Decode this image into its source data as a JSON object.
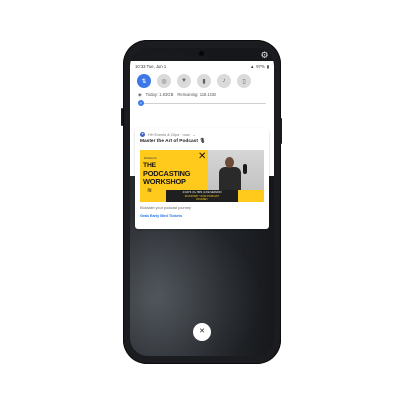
{
  "status_bar": {
    "time_date": "10:33 Tue, Jun 1",
    "battery": "97%"
  },
  "quick_settings": {
    "tiles": [
      {
        "name": "mobile-data",
        "glyph": "⇅",
        "active": true
      },
      {
        "name": "hotspot",
        "glyph": "◎",
        "active": false
      },
      {
        "name": "wifi",
        "glyph": "▼",
        "active": false
      },
      {
        "name": "flashlight",
        "glyph": "▮",
        "active": false
      },
      {
        "name": "notifications",
        "glyph": "♪",
        "active": false
      },
      {
        "name": "rotate",
        "glyph": "▯",
        "active": false
      }
    ],
    "data_usage": {
      "today": "Today: 1.93GB",
      "remaining": "Remaining: 118.1GB"
    },
    "accent": "#3c79e6"
  },
  "notification": {
    "app_name": "HH Events & Clips · now",
    "title": "Master the Art of Podcast 🎙",
    "banner": {
      "brand": "Workbench",
      "line1": "THE",
      "line2": "PODCASTING",
      "line3": "WORKSHOP",
      "strip_line1": "4 DAYS | 8+ HRS | LIVE SESSION",
      "strip_line2": "KICKSTART YOUR PODCAST",
      "strip_line3": "JOURNEY",
      "accent": "#ffca1b"
    },
    "body": "Kickstart your podcast journey",
    "action": "Grab Early Bird Tickets"
  },
  "close_button": {
    "glyph": "✕"
  }
}
